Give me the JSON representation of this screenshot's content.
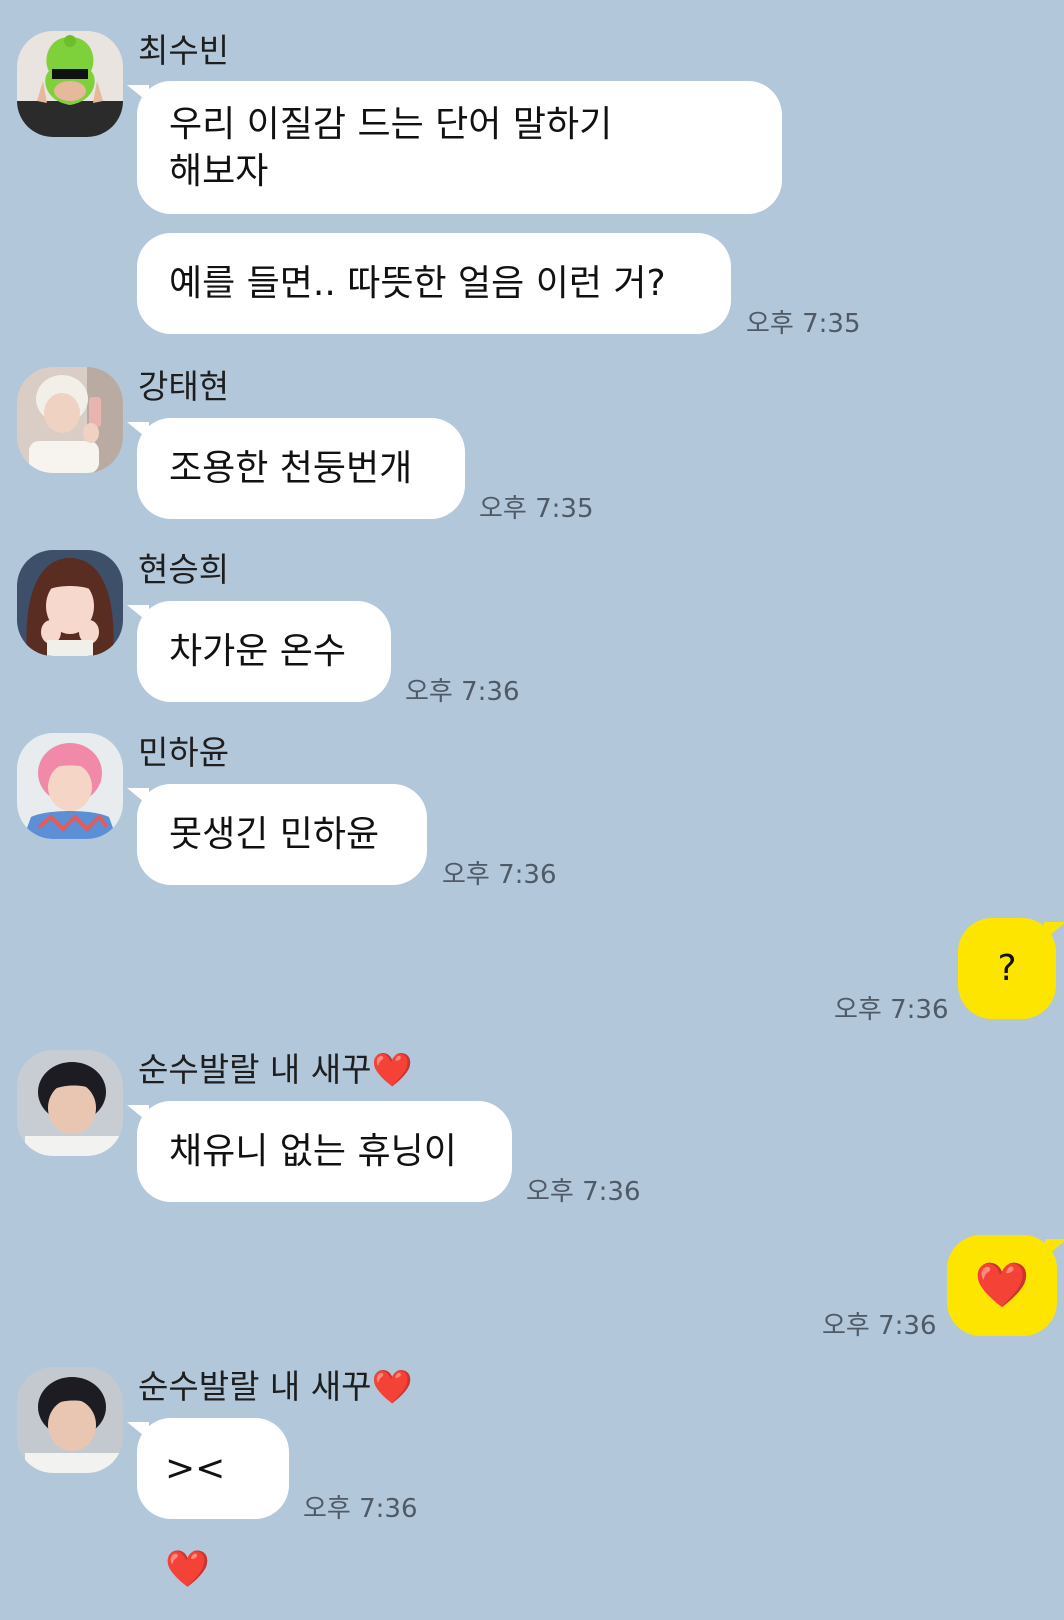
{
  "chat": {
    "messages": [
      {
        "sender": "최수빈",
        "lines": [
          "우리 이질감 드는 단어 말하기",
          "해보자"
        ]
      },
      {
        "sender": "최수빈",
        "lines": [
          "예를 들면.. 따뜻한 얼음 이런 거?"
        ],
        "time": "오후 7:35"
      },
      {
        "sender": "강태현",
        "lines": [
          "조용한 천둥번개"
        ],
        "time": "오후 7:35"
      },
      {
        "sender": "현승희",
        "lines": [
          "차가운 온수"
        ],
        "time": "오후 7:36"
      },
      {
        "sender": "민하윤",
        "lines": [
          "못생긴 민하윤"
        ],
        "time": "오후 7:36"
      },
      {
        "sender": "me",
        "lines": [
          "?"
        ],
        "time": "오후 7:36"
      },
      {
        "sender": "순수발랄 내 새꾸",
        "sender_emoji": "❤️",
        "lines": [
          "채유니 없는 휴닝이"
        ],
        "time": "오후 7:36"
      },
      {
        "sender": "me",
        "lines": [
          "❤️"
        ],
        "time": "오후 7:36"
      },
      {
        "sender": "순수발랄 내 새꾸",
        "sender_emoji": "❤️",
        "lines": [
          "><"
        ],
        "line_emoji": "❤️",
        "time": "오후 7:36"
      }
    ]
  },
  "colors": {
    "background": "#b2c7da",
    "incoming_bubble": "#ffffff",
    "outgoing_bubble": "#fee500",
    "heart": "#e8132b"
  },
  "icons": {
    "avatar_1": "green-hat-avatar-icon",
    "avatar_2": "mirror-selfie-avatar-icon",
    "avatar_3": "girl-avatar-icon",
    "avatar_4": "pink-hair-avatar-icon",
    "avatar_5": "dark-hair-avatar-icon",
    "avatar_6": "dark-hair-avatar-icon"
  }
}
